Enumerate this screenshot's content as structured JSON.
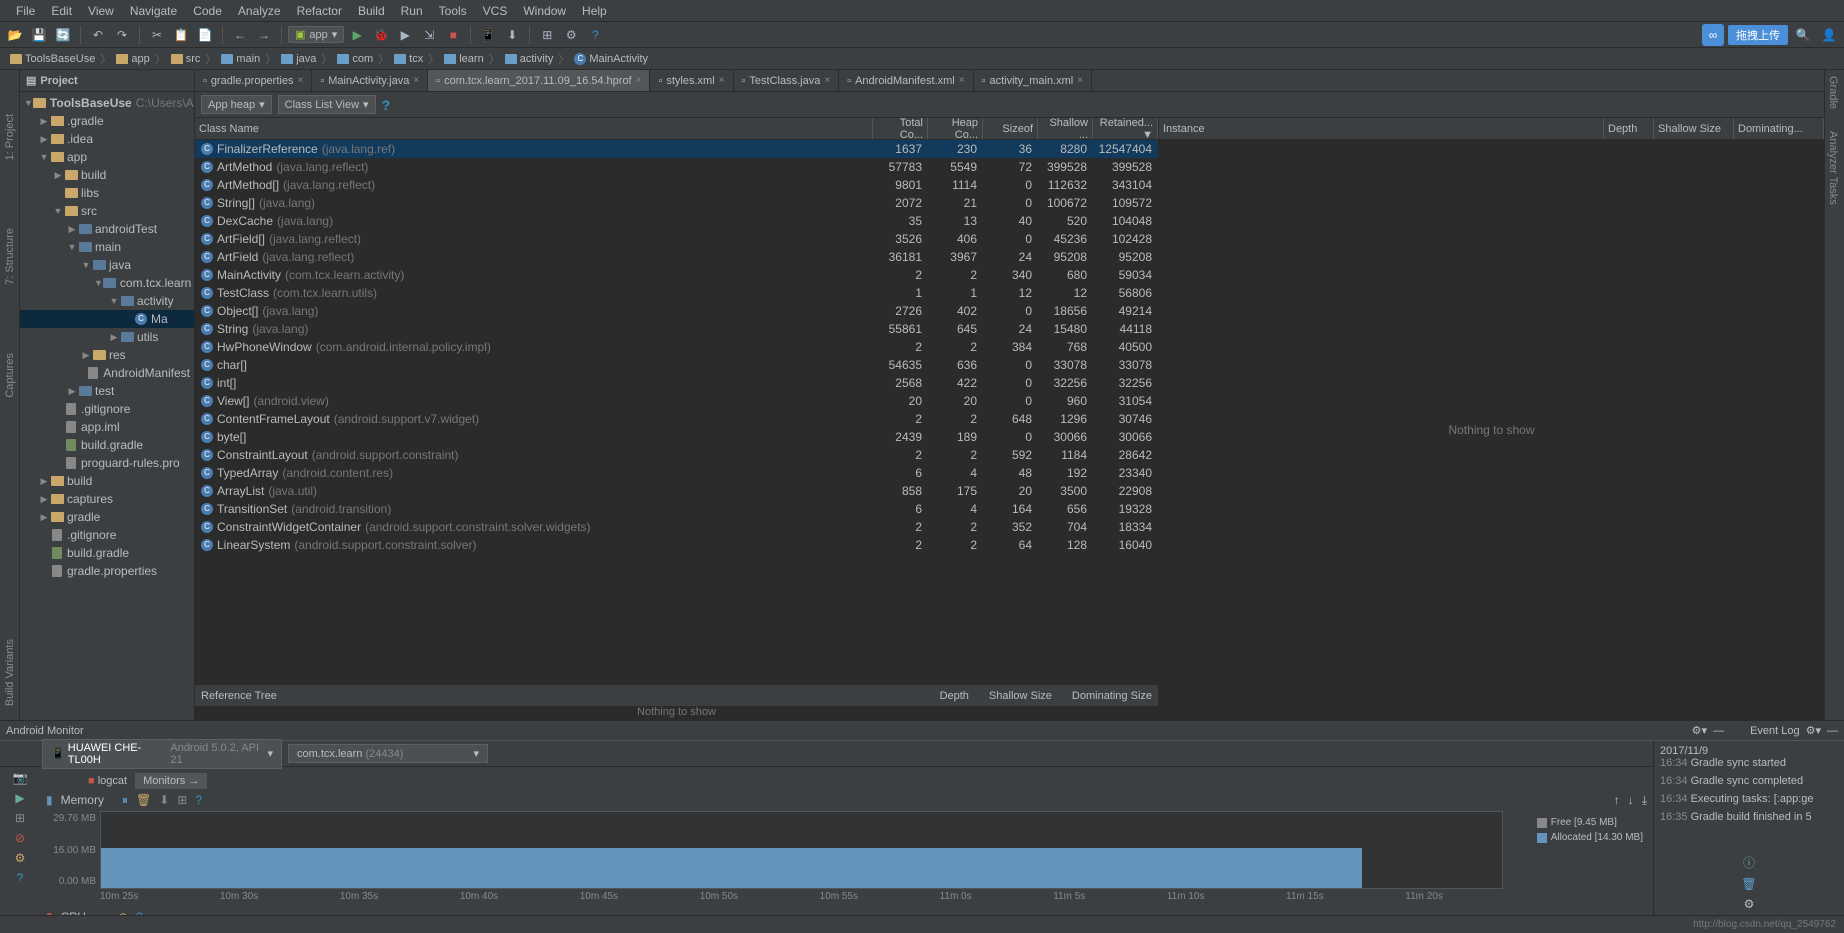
{
  "menu": [
    "File",
    "Edit",
    "View",
    "Navigate",
    "Code",
    "Analyze",
    "Refactor",
    "Build",
    "Run",
    "Tools",
    "VCS",
    "Window",
    "Help"
  ],
  "toolbar": {
    "run_config": "app",
    "upload_label": "拖拽上传"
  },
  "breadcrumb": [
    "ToolsBaseUse",
    "app",
    "src",
    "main",
    "java",
    "com",
    "tcx",
    "learn",
    "activity",
    "MainActivity"
  ],
  "project": {
    "title": "Project",
    "root": "ToolsBaseUse",
    "root_path": "C:\\Users\\Adm",
    "tree": [
      {
        "d": 1,
        "t": "folder-y",
        "n": ".gradle",
        "exp": "▶"
      },
      {
        "d": 1,
        "t": "folder-y",
        "n": ".idea",
        "exp": "▶"
      },
      {
        "d": 1,
        "t": "folder-y",
        "n": "app",
        "exp": "▼"
      },
      {
        "d": 2,
        "t": "folder-y",
        "n": "build",
        "exp": "▶"
      },
      {
        "d": 2,
        "t": "folder-y",
        "n": "libs",
        "exp": ""
      },
      {
        "d": 2,
        "t": "folder-y",
        "n": "src",
        "exp": "▼"
      },
      {
        "d": 3,
        "t": "folder-b",
        "n": "androidTest",
        "exp": "▶"
      },
      {
        "d": 3,
        "t": "folder-b",
        "n": "main",
        "exp": "▼"
      },
      {
        "d": 4,
        "t": "folder-b",
        "n": "java",
        "exp": "▼"
      },
      {
        "d": 5,
        "t": "folder-b",
        "n": "com.tcx.learn",
        "exp": "▼"
      },
      {
        "d": 6,
        "t": "folder-b",
        "n": "activity",
        "exp": "▼"
      },
      {
        "d": 7,
        "t": "class-c",
        "n": "MainActivity",
        "exp": "",
        "sel": true,
        "cut": true
      },
      {
        "d": 6,
        "t": "folder-b",
        "n": "utils",
        "exp": "▶"
      },
      {
        "d": 4,
        "t": "folder-y",
        "n": "res",
        "exp": "▶"
      },
      {
        "d": 4,
        "t": "file-g",
        "n": "AndroidManifest",
        "exp": ""
      },
      {
        "d": 3,
        "t": "folder-b",
        "n": "test",
        "exp": "▶"
      },
      {
        "d": 2,
        "t": "file-g",
        "n": ".gitignore",
        "exp": ""
      },
      {
        "d": 2,
        "t": "file-g",
        "n": "app.iml",
        "exp": ""
      },
      {
        "d": 2,
        "t": "file-i",
        "n": "build.gradle",
        "exp": ""
      },
      {
        "d": 2,
        "t": "file-g",
        "n": "proguard-rules.pro",
        "exp": ""
      },
      {
        "d": 1,
        "t": "folder-y",
        "n": "build",
        "exp": "▶"
      },
      {
        "d": 1,
        "t": "folder-y",
        "n": "captures",
        "exp": "▶"
      },
      {
        "d": 1,
        "t": "folder-y",
        "n": "gradle",
        "exp": "▶"
      },
      {
        "d": 1,
        "t": "file-g",
        "n": ".gitignore",
        "exp": ""
      },
      {
        "d": 1,
        "t": "file-i",
        "n": "build.gradle",
        "exp": ""
      },
      {
        "d": 1,
        "t": "file-g",
        "n": "gradle.properties",
        "exp": ""
      }
    ]
  },
  "tabs": [
    {
      "label": "gradle.properties",
      "active": false
    },
    {
      "label": "MainActivity.java",
      "active": false
    },
    {
      "label": "com.tcx.learn_2017.11.09_16.54.hprof",
      "active": true
    },
    {
      "label": "styles.xml",
      "active": false
    },
    {
      "label": "TestClass.java",
      "active": false
    },
    {
      "label": "AndroidManifest.xml",
      "active": false
    },
    {
      "label": "activity_main.xml",
      "active": false
    }
  ],
  "heap": {
    "app_heap": "App heap",
    "view": "Class List View",
    "cols": [
      "Class Name",
      "Total Co...",
      "Heap Co...",
      "Sizeof",
      "Shallow ...",
      "Retained... ▼"
    ],
    "instance_col": "Instance",
    "right_cols": [
      "Depth",
      "Shallow Size",
      "Dominating..."
    ],
    "nothing": "Nothing to show",
    "rows": [
      {
        "n": "FinalizerReference",
        "p": "(java.lang.ref)",
        "c": [
          1637,
          230,
          36,
          8280,
          12547404
        ],
        "sel": true
      },
      {
        "n": "ArtMethod",
        "p": "(java.lang.reflect)",
        "c": [
          57783,
          5549,
          72,
          399528,
          399528
        ]
      },
      {
        "n": "ArtMethod[]",
        "p": "(java.lang.reflect)",
        "c": [
          9801,
          1114,
          0,
          112632,
          343104
        ]
      },
      {
        "n": "String[]",
        "p": "(java.lang)",
        "c": [
          2072,
          21,
          0,
          100672,
          109572
        ]
      },
      {
        "n": "DexCache",
        "p": "(java.lang)",
        "c": [
          35,
          13,
          40,
          520,
          104048
        ]
      },
      {
        "n": "ArtField[]",
        "p": "(java.lang.reflect)",
        "c": [
          3526,
          406,
          0,
          45236,
          102428
        ]
      },
      {
        "n": "ArtField",
        "p": "(java.lang.reflect)",
        "c": [
          36181,
          3967,
          24,
          95208,
          95208
        ]
      },
      {
        "n": "MainActivity",
        "p": "(com.tcx.learn.activity)",
        "c": [
          2,
          2,
          340,
          680,
          59034
        ]
      },
      {
        "n": "TestClass",
        "p": "(com.tcx.learn.utils)",
        "c": [
          1,
          1,
          12,
          12,
          56806
        ]
      },
      {
        "n": "Object[]",
        "p": "(java.lang)",
        "c": [
          2726,
          402,
          0,
          18656,
          49214
        ]
      },
      {
        "n": "String",
        "p": "(java.lang)",
        "c": [
          55861,
          645,
          24,
          15480,
          44118
        ]
      },
      {
        "n": "HwPhoneWindow",
        "p": "(com.android.internal.policy.impl)",
        "c": [
          2,
          2,
          384,
          768,
          40500
        ]
      },
      {
        "n": "char[]",
        "p": "",
        "c": [
          54635,
          636,
          0,
          33078,
          33078
        ]
      },
      {
        "n": "int[]",
        "p": "",
        "c": [
          2568,
          422,
          0,
          32256,
          32256
        ]
      },
      {
        "n": "View[]",
        "p": "(android.view)",
        "c": [
          20,
          20,
          0,
          960,
          31054
        ]
      },
      {
        "n": "ContentFrameLayout",
        "p": "(android.support.v7.widget)",
        "c": [
          2,
          2,
          648,
          1296,
          30746
        ]
      },
      {
        "n": "byte[]",
        "p": "",
        "c": [
          2439,
          189,
          0,
          30066,
          30066
        ]
      },
      {
        "n": "ConstraintLayout",
        "p": "(android.support.constraint)",
        "c": [
          2,
          2,
          592,
          1184,
          28642
        ]
      },
      {
        "n": "TypedArray",
        "p": "(android.content.res)",
        "c": [
          6,
          4,
          48,
          192,
          23340
        ]
      },
      {
        "n": "ArrayList",
        "p": "(java.util)",
        "c": [
          858,
          175,
          20,
          3500,
          22908
        ]
      },
      {
        "n": "TransitionSet",
        "p": "(android.transition)",
        "c": [
          6,
          4,
          164,
          656,
          19328
        ]
      },
      {
        "n": "ConstraintWidgetContainer",
        "p": "(android.support.constraint.solver.widgets)",
        "c": [
          2,
          2,
          352,
          704,
          18334
        ]
      },
      {
        "n": "LinearSystem",
        "p": "(android.support.constraint.solver)",
        "c": [
          2,
          2,
          64,
          128,
          16040
        ]
      }
    ],
    "ref_tree": "Reference Tree",
    "ref_cols": [
      "Depth",
      "Shallow Size",
      "Dominating Size"
    ],
    "ref_nothing": "Nothing to show"
  },
  "monitor": {
    "title": "Android Monitor",
    "device": "HUAWEI CHE-TL00H",
    "device_info": "Android 5.0.2, API 21",
    "process": "com.tcx.learn",
    "process_id": "(24434)",
    "tabs": {
      "logcat": "logcat",
      "monitors": "Monitors"
    },
    "memory_label": "Memory",
    "cpu_label": "CPU",
    "y_ticks": [
      "29.76 MB",
      "16.00 MB",
      "0.00 MB"
    ],
    "x_ticks": [
      "10m 25s",
      "10m 30s",
      "10m 35s",
      "10m 40s",
      "10m 45s",
      "10m 50s",
      "10m 55s",
      "11m 0s",
      "11m 5s",
      "11m 10s",
      "11m 15s",
      "11m 20s"
    ],
    "legend_free": "Free [9.45 MB]",
    "legend_alloc": "Allocated [14.30 MB]"
  },
  "events": {
    "title": "Event Log",
    "items": [
      {
        "date": "2017/11/9",
        "time": "16:34",
        "msg": "Gradle sync started"
      },
      {
        "date": "",
        "time": "16:34",
        "msg": "Gradle sync completed"
      },
      {
        "date": "",
        "time": "16:34",
        "msg": "Executing tasks: [:app:ge"
      },
      {
        "date": "",
        "time": "16:35",
        "msg": "Gradle build finished in 5"
      }
    ]
  },
  "watermark": "http://blog.csdn.net/qq_2549762",
  "chart_data": {
    "type": "area",
    "title": "Memory",
    "x": [
      "10m 25s",
      "10m 30s",
      "10m 35s",
      "10m 40s",
      "10m 45s",
      "10m 50s",
      "10m 55s",
      "11m 0s",
      "11m 5s",
      "11m 10s",
      "11m 15s",
      "11m 20s"
    ],
    "series": [
      {
        "name": "Free",
        "values": [
          9.45,
          9.45,
          9.45,
          9.45,
          9.45,
          9.45,
          9.45,
          9.45,
          9.45,
          9.45,
          9.45,
          9.45
        ],
        "color": "#aaaaaa"
      },
      {
        "name": "Allocated",
        "values": [
          14.3,
          14.3,
          14.3,
          14.3,
          14.3,
          14.3,
          14.3,
          14.3,
          14.3,
          14.3,
          14.3,
          14.3
        ],
        "color": "#6494bc"
      }
    ],
    "ylabel": "MB",
    "ylim": [
      0,
      29.76
    ]
  }
}
